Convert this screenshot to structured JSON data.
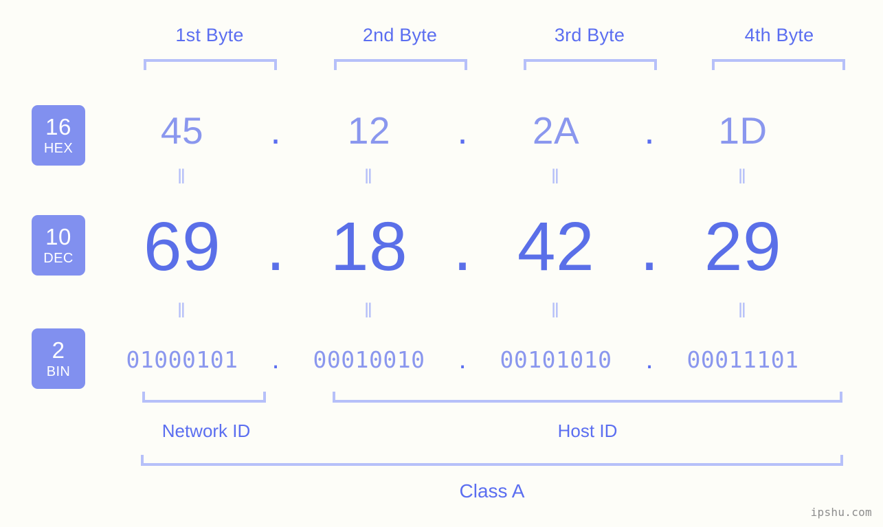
{
  "watermark": "ipshu.com",
  "colors": {
    "background": "#fdfdf8",
    "badge_bg": "#8190ef",
    "badge_text": "#ffffff",
    "accent_strong": "#5a6fe8",
    "accent_label": "#5b6ef0",
    "accent_light": "#8a97ee",
    "bracket": "#b6c0f9",
    "watermark": "#8d8d8d"
  },
  "byte_headers": [
    {
      "label": "1st Byte"
    },
    {
      "label": "2nd Byte"
    },
    {
      "label": "3rd Byte"
    },
    {
      "label": "4th Byte"
    }
  ],
  "radix_badges": [
    {
      "number": "16",
      "name": "HEX"
    },
    {
      "number": "10",
      "name": "DEC"
    },
    {
      "number": "2",
      "name": "BIN"
    }
  ],
  "separators": {
    "dot": ".",
    "equals": "‖"
  },
  "rows": {
    "hex": {
      "radix": "16",
      "name": "HEX",
      "values": [
        "45",
        "12",
        "2A",
        "1D"
      ]
    },
    "dec": {
      "radix": "10",
      "name": "DEC",
      "values": [
        "69",
        "18",
        "42",
        "29"
      ]
    },
    "bin": {
      "radix": "2",
      "name": "BIN",
      "values": [
        "01000101",
        "00010010",
        "00101010",
        "00011101"
      ]
    }
  },
  "address": {
    "hex": "45.12.2A.1D",
    "dec": "69.18.42.29",
    "bin": "01000101.00010010.00101010.00011101"
  },
  "partitions": {
    "network_id": "Network ID",
    "host_id": "Host ID",
    "class": "Class A"
  }
}
